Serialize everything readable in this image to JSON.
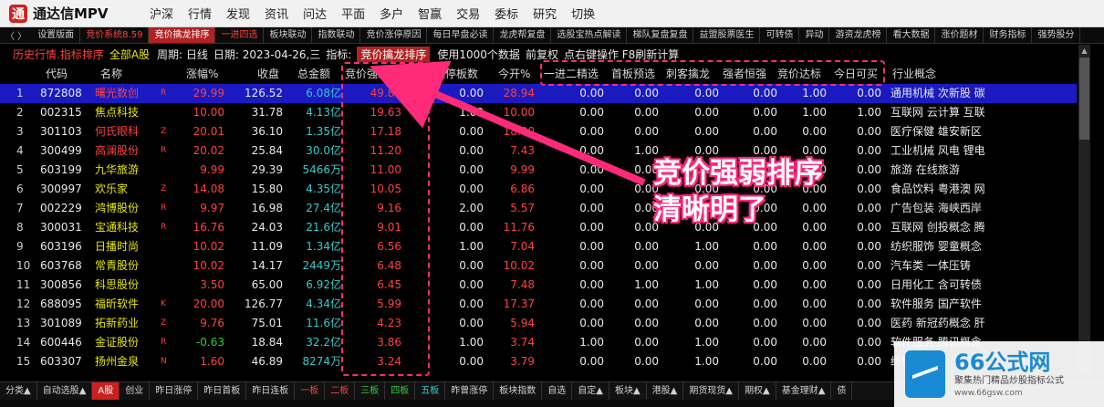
{
  "titlebar": {
    "logo": "通",
    "title": "通达信MPV",
    "menu": [
      "沪深",
      "行情",
      "发现",
      "资讯",
      "问达",
      "平面",
      "多户",
      "智赢",
      "交易",
      "委标",
      "研究",
      "切换"
    ]
  },
  "toolbar": {
    "nav": "〈 〉",
    "items": [
      {
        "label": "设置版面",
        "style": ""
      },
      {
        "label": "竞价系统8.59",
        "style": "red"
      },
      {
        "label": "竞价擒龙排序",
        "style": "act"
      },
      {
        "label": "一进四选",
        "style": "red"
      },
      {
        "label": "板块联动",
        "style": ""
      },
      {
        "label": "指数联动",
        "style": ""
      },
      {
        "label": "竞价涨停原因",
        "style": ""
      },
      {
        "label": "每日早盘必读",
        "style": ""
      },
      {
        "label": "龙虎帮复盘",
        "style": ""
      },
      {
        "label": "选股宝热点解读",
        "style": ""
      },
      {
        "label": "梯队复盘复盘",
        "style": ""
      },
      {
        "label": "益盟股票医生",
        "style": ""
      },
      {
        "label": "可转债",
        "style": ""
      },
      {
        "label": "异动",
        "style": ""
      },
      {
        "label": "游资龙虎榜",
        "style": ""
      },
      {
        "label": "看大数据",
        "style": ""
      },
      {
        "label": "涨价题材",
        "style": ""
      },
      {
        "label": "财务指标",
        "style": ""
      },
      {
        "label": "强势股分",
        "style": ""
      }
    ]
  },
  "infobar": {
    "history": "历史行情.指标排序",
    "scope": "全部A股",
    "period": "周期: 日线",
    "date": "日期: 2023-04-26,三",
    "indicator_label": "指标:",
    "indicator": "竞价擒龙排序",
    "usage": "使用1000个数据",
    "adjust": "前复权",
    "hint": "点右键操作 F8刷新计算"
  },
  "headers": {
    "code": "代码",
    "name": "名称",
    "chg": "涨幅%",
    "close": "收盘",
    "amount": "总金额",
    "strength": "竞价强弱↓",
    "ylimit": "昨日涨停板数",
    "open": "今开%",
    "c1": "一进二精选",
    "c2": "首板预选",
    "c3": "刺客擒龙",
    "c4": "强者恒强",
    "c5": "竞价达标",
    "c6": "今日可买",
    "concept": "行业概念"
  },
  "rows": [
    {
      "idx": "1",
      "code": "872808",
      "name": "曙光数创",
      "mk": "R",
      "chg": "29.99",
      "close": "126.52",
      "amount": "6.08亿",
      "strength": "49.85",
      "ylimit": "0.00",
      "open": "28.94",
      "c1": "0.00",
      "c2": "0.00",
      "c3": "0.00",
      "c4": "0.00",
      "c5": "1.00",
      "c6": "0.00",
      "concept": "通用机械  次新股 碳",
      "namecolor": "red"
    },
    {
      "idx": "2",
      "code": "002315",
      "name": "焦点科技",
      "mk": "",
      "chg": "10.00",
      "close": "31.78",
      "amount": "4.13亿",
      "strength": "19.63",
      "ylimit": "1.00",
      "open": "10.00",
      "c1": "0.00",
      "c2": "0.00",
      "c3": "0.00",
      "c4": "0.00",
      "c5": "1.00",
      "c6": "1.00",
      "concept": "互联网  云计算 互联",
      "namecolor": ""
    },
    {
      "idx": "3",
      "code": "301103",
      "name": "何氏眼科",
      "mk": "Z",
      "chg": "20.01",
      "close": "36.10",
      "amount": "1.35亿",
      "strength": "17.18",
      "ylimit": "0.00",
      "open": "18.00",
      "c1": "0.00",
      "c2": "0.00",
      "c3": "0.00",
      "c4": "0.00",
      "c5": "0.00",
      "c6": "0.00",
      "concept": "医疗保健  雄安新区",
      "namecolor": "red"
    },
    {
      "idx": "4",
      "code": "300499",
      "name": "高澜股份",
      "mk": "R",
      "chg": "20.02",
      "close": "25.84",
      "amount": "30.0亿",
      "strength": "11.20",
      "ylimit": "0.00",
      "open": "7.43",
      "c1": "0.00",
      "c2": "1.00",
      "c3": "0.00",
      "c4": "0.00",
      "c5": "0.00",
      "c6": "0.00",
      "concept": "工业机械  风电 锂电",
      "namecolor": "red"
    },
    {
      "idx": "5",
      "code": "603199",
      "name": "九华旅游",
      "mk": "",
      "chg": "9.99",
      "close": "29.39",
      "amount": "5466万",
      "strength": "11.00",
      "ylimit": "0.00",
      "open": "9.99",
      "c1": "0.00",
      "c2": "0.00",
      "c3": "0.00",
      "c4": "0.00",
      "c5": "0.00",
      "c6": "0.00",
      "concept": "旅游  在线旅游",
      "namecolor": ""
    },
    {
      "idx": "6",
      "code": "300997",
      "name": "欢乐家",
      "mk": "Z",
      "chg": "14.08",
      "close": "15.80",
      "amount": "4.35亿",
      "strength": "10.05",
      "ylimit": "0.00",
      "open": "6.86",
      "c1": "0.00",
      "c2": "0.00",
      "c3": "0.00",
      "c4": "0.00",
      "c5": "0.00",
      "c6": "0.00",
      "concept": "食品饮料  粤港澳 网",
      "namecolor": ""
    },
    {
      "idx": "7",
      "code": "002229",
      "name": "鸿博股份",
      "mk": "R",
      "chg": "9.97",
      "close": "16.98",
      "amount": "27.4亿",
      "strength": "9.16",
      "ylimit": "2.00",
      "open": "5.57",
      "c1": "0.00",
      "c2": "0.00",
      "c3": "0.00",
      "c4": "0.00",
      "c5": "0.00",
      "c6": "0.00",
      "concept": "广告包装  海峡西岸",
      "namecolor": ""
    },
    {
      "idx": "8",
      "code": "300031",
      "name": "宝通科技",
      "mk": "R",
      "chg": "16.76",
      "close": "24.03",
      "amount": "21.6亿",
      "strength": "9.01",
      "ylimit": "0.00",
      "open": "11.76",
      "c1": "0.00",
      "c2": "0.00",
      "c3": "0.00",
      "c4": "0.00",
      "c5": "0.00",
      "c6": "0.00",
      "concept": "互联网  创投概念 腾",
      "namecolor": ""
    },
    {
      "idx": "9",
      "code": "603196",
      "name": "日播时尚",
      "mk": "",
      "chg": "10.02",
      "close": "11.09",
      "amount": "1.34亿",
      "strength": "6.56",
      "ylimit": "1.00",
      "open": "7.04",
      "c1": "0.00",
      "c2": "0.00",
      "c3": "1.00",
      "c4": "0.00",
      "c5": "0.00",
      "c6": "0.00",
      "concept": "纺织服饰  婴童概念",
      "namecolor": ""
    },
    {
      "idx": "10",
      "code": "603768",
      "name": "常青股份",
      "mk": "",
      "chg": "10.02",
      "close": "14.17",
      "amount": "2449万",
      "strength": "6.48",
      "ylimit": "0.00",
      "open": "10.02",
      "c1": "0.00",
      "c2": "0.00",
      "c3": "0.00",
      "c4": "0.00",
      "c5": "0.00",
      "c6": "0.00",
      "concept": "汽车类  一体压铸",
      "namecolor": ""
    },
    {
      "idx": "11",
      "code": "300856",
      "name": "科思股份",
      "mk": "",
      "chg": "3.50",
      "close": "65.00",
      "amount": "6.92亿",
      "strength": "6.45",
      "ylimit": "0.00",
      "open": "7.48",
      "c1": "0.00",
      "c2": "1.00",
      "c3": "1.00",
      "c4": "0.00",
      "c5": "0.00",
      "c6": "0.00",
      "concept": "日用化工  含可转债",
      "namecolor": ""
    },
    {
      "idx": "12",
      "code": "688095",
      "name": "福昕软件",
      "mk": "K",
      "chg": "20.00",
      "close": "126.77",
      "amount": "4.34亿",
      "strength": "5.99",
      "ylimit": "0.00",
      "open": "17.37",
      "c1": "0.00",
      "c2": "0.00",
      "c3": "0.00",
      "c4": "0.00",
      "c5": "0.00",
      "c6": "0.00",
      "concept": "软件服务  国产软件",
      "namecolor": ""
    },
    {
      "idx": "13",
      "code": "301089",
      "name": "拓新药业",
      "mk": "Z",
      "chg": "9.76",
      "close": "75.01",
      "amount": "11.6亿",
      "strength": "4.23",
      "ylimit": "0.00",
      "open": "5.94",
      "c1": "0.00",
      "c2": "0.00",
      "c3": "0.00",
      "c4": "0.00",
      "c5": "0.00",
      "c6": "0.00",
      "concept": "医药  新冠药概念 肝",
      "namecolor": ""
    },
    {
      "idx": "14",
      "code": "600446",
      "name": "金证股份",
      "mk": "R",
      "chg": "-0.63",
      "close": "18.84",
      "amount": "32.2亿",
      "strength": "3.86",
      "ylimit": "1.00",
      "open": "3.74",
      "c1": "1.00",
      "c2": "0.00",
      "c3": "1.00",
      "c4": "0.00",
      "c5": "0.00",
      "c6": "0.00",
      "concept": "软件服务  腾讯概念",
      "namecolor": ""
    },
    {
      "idx": "15",
      "code": "603307",
      "name": "扬州金泉",
      "mk": "N",
      "chg": "1.60",
      "close": "46.89",
      "amount": "8274万",
      "strength": "3.24",
      "ylimit": "0.00",
      "open": "3.79",
      "c1": "0.00",
      "c2": "0.00",
      "c3": "1.00",
      "c4": "0.00",
      "c5": "0.00",
      "c6": "0.00",
      "concept": "纺织服饰",
      "namecolor": ""
    }
  ],
  "overlay": {
    "line1": "竞价强弱排序",
    "line2": "清晰明了"
  },
  "bottom_tabs": [
    {
      "label": "分类▲",
      "style": ""
    },
    {
      "label": "自动选股▲",
      "style": ""
    },
    {
      "label": "A股",
      "style": "act"
    },
    {
      "label": "创业",
      "style": ""
    },
    {
      "label": "昨日涨停",
      "style": ""
    },
    {
      "label": "昨日首板",
      "style": ""
    },
    {
      "label": "昨日连板",
      "style": ""
    },
    {
      "label": "一板",
      "style": "red"
    },
    {
      "label": "二板",
      "style": "red"
    },
    {
      "label": "三板",
      "style": "grn"
    },
    {
      "label": "四板",
      "style": "grn"
    },
    {
      "label": "五板",
      "style": "cyn"
    },
    {
      "label": "昨曾涨停",
      "style": ""
    },
    {
      "label": "板块指数",
      "style": ""
    },
    {
      "label": "自选",
      "style": ""
    },
    {
      "label": "自定▲",
      "style": ""
    },
    {
      "label": "板块▲",
      "style": ""
    },
    {
      "label": "港股▲",
      "style": ""
    },
    {
      "label": "期货现货▲",
      "style": ""
    },
    {
      "label": "期权▲",
      "style": ""
    },
    {
      "label": "基金理财▲",
      "style": ""
    },
    {
      "label": "债",
      "style": ""
    }
  ],
  "watermark": {
    "title": "66公式网",
    "sub": "聚集热门精品炒股指标公式",
    "url": "www.66gsw.com"
  },
  "colors": {
    "up": "#ff4040",
    "down": "#33cc33",
    "select": "#1a1ac0",
    "annotation": "#ff2a7a"
  }
}
